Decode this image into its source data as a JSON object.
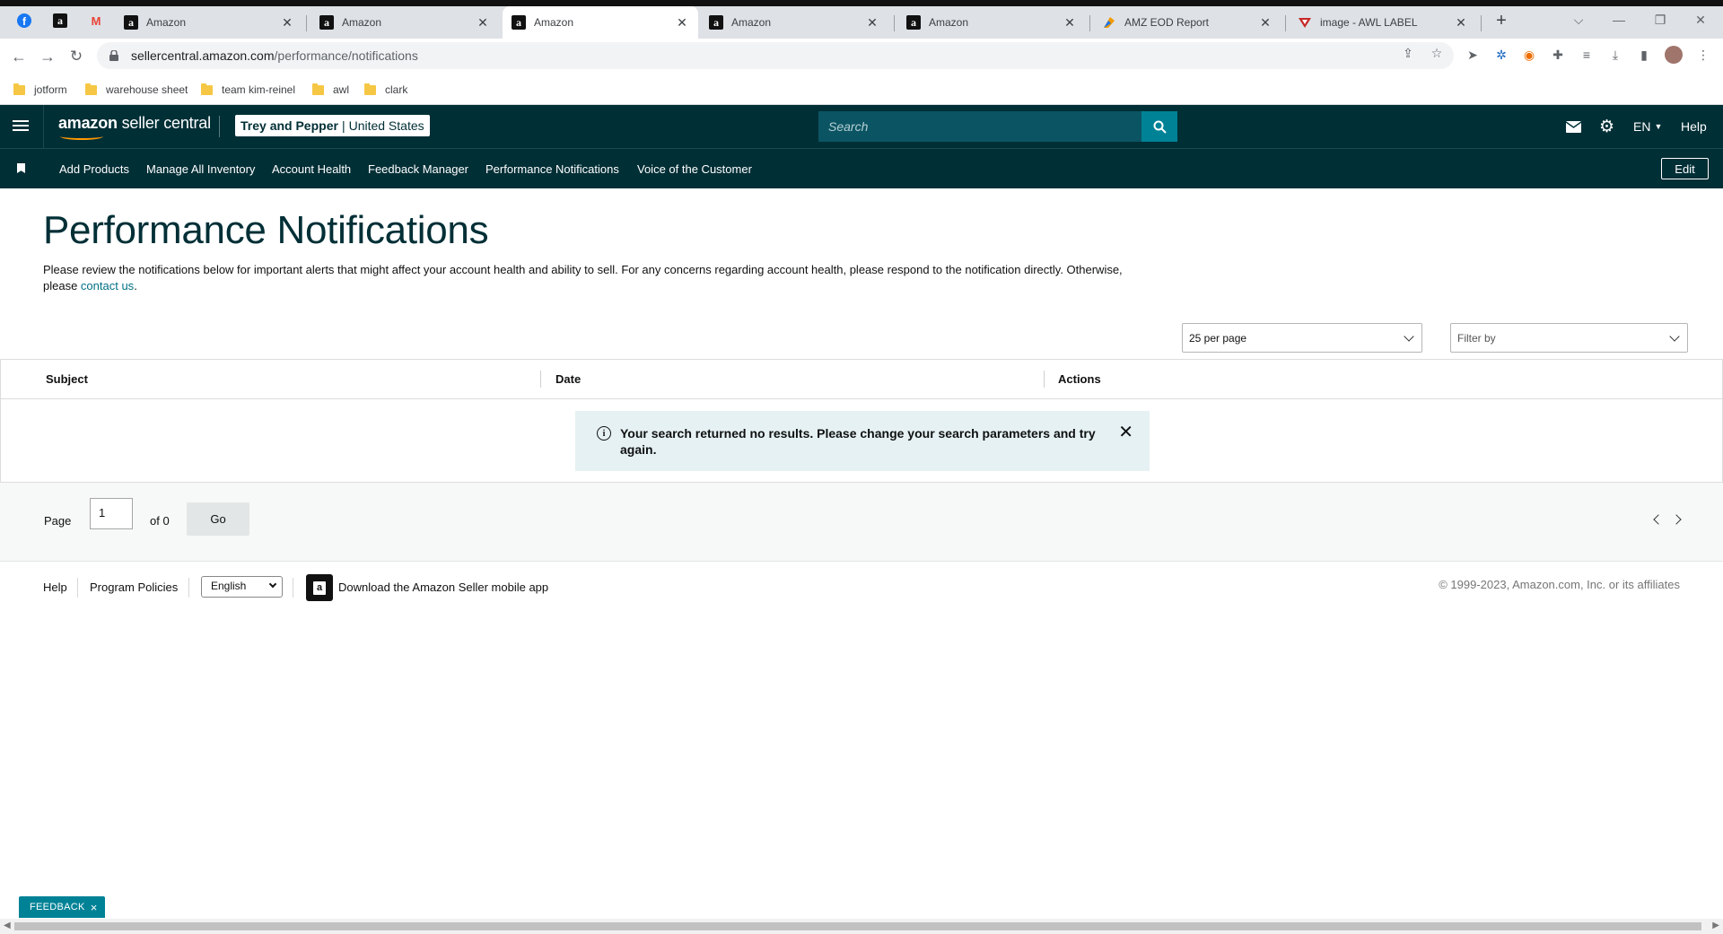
{
  "browser": {
    "tabs": [
      {
        "title": "Amazon",
        "icon": "amazon-icon",
        "active": false
      },
      {
        "title": "Amazon",
        "icon": "amazon-icon",
        "active": false
      },
      {
        "title": "Amazon",
        "icon": "amazon-icon",
        "active": true
      },
      {
        "title": "Amazon",
        "icon": "amazon-icon",
        "active": false
      },
      {
        "title": "Amazon",
        "icon": "amazon-icon",
        "active": false
      },
      {
        "title": "AMZ EOD Report",
        "icon": "report-icon",
        "active": false
      },
      {
        "title": "image - AWL LABEL",
        "icon": "awl-icon",
        "active": false
      }
    ],
    "pinned_tabs": [
      "facebook-icon",
      "amazon-icon",
      "gmail-icon"
    ],
    "url_host": "sellercentral.amazon.com",
    "url_path": "/performance/notifications",
    "bookmarks": [
      "jotform",
      "warehouse sheet",
      "team kim-reinel",
      "awl",
      "clark"
    ]
  },
  "header": {
    "logo_bold": "amazon",
    "logo_rest": " seller central",
    "account_name": "Trey and Pepper",
    "account_sep": "|",
    "account_region": "United States",
    "search_placeholder": "Search",
    "language": "EN",
    "help": "Help"
  },
  "nav": {
    "items": [
      "Add Products",
      "Manage All Inventory",
      "Account Health",
      "Feedback Manager",
      "Performance Notifications",
      "Voice of the Customer"
    ],
    "edit": "Edit"
  },
  "main": {
    "title": "Performance Notifications",
    "description": "Please review the notifications below for important alerts that might affect your account health and ability to sell. For any concerns regarding account health, please respond to the notification directly. Otherwise, please ",
    "description_link": "contact us",
    "description_end": ".",
    "per_page": "25 per page",
    "filter_placeholder": "Filter by",
    "columns": [
      "Subject",
      "Date",
      "Actions"
    ],
    "empty_message": "Your search returned no results. Please change your search parameters and try again.",
    "pager": {
      "label": "Page",
      "current": "1",
      "of": "of 0",
      "go": "Go"
    }
  },
  "footer": {
    "help": "Help",
    "program_policies": "Program Policies",
    "language": "English",
    "app_promo": "Download the Amazon Seller mobile app",
    "copyright": "© 1999-2023, Amazon.com, Inc. or its affiliates"
  },
  "feedback": {
    "label": "FEEDBACK",
    "close": "×"
  },
  "colors": {
    "brand_dark": "#002f36",
    "accent": "#008296",
    "link": "#007185"
  }
}
